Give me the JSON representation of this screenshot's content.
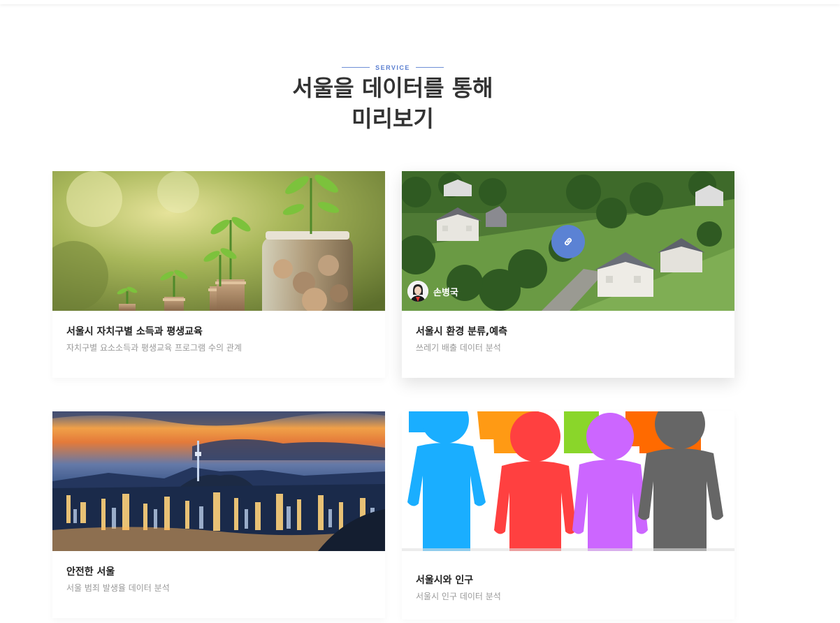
{
  "section": {
    "eyebrow": "SERVICE",
    "title_line1": "서울을 데이터를 통해",
    "title_line2": "미리보기"
  },
  "cards": [
    {
      "title": "서울시 자치구별 소득과 평생교육",
      "subtitle": "자치구별 요소소득과 평생교육 프로그램 수의 관계",
      "image": "coin-stacks-with-plants"
    },
    {
      "title": "서울시 환경 분류,예측",
      "subtitle": "쓰레기 배출 데이터 분석",
      "image": "aerial-suburban-houses",
      "author": "손병국",
      "link_icon": "link-icon"
    },
    {
      "title": "안전한 서울",
      "subtitle": "서울 범죄 발생율 데이터 분석",
      "image": "seoul-night-skyline"
    },
    {
      "title": "서울시와 인구",
      "subtitle": "서울시 인구 데이터 분석",
      "image": "colorful-people-figures"
    }
  ],
  "colors": {
    "accent": "#5b82d4",
    "title": "#333333",
    "muted": "#9a9a9a"
  }
}
